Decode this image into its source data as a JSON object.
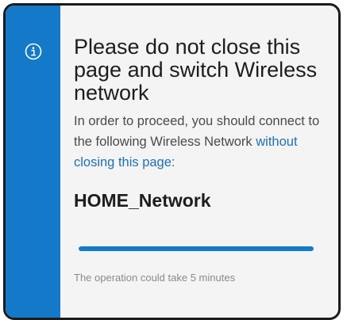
{
  "dialog": {
    "icon": "info-icon",
    "title": "Please do not close this page and switch Wireless network",
    "description_text": "In order to proceed, you should connect to the following Wireless Network ",
    "description_link": "without closing this page:",
    "network_name": "HOME_Network",
    "progress": 1.0,
    "note": "The operation could take 5 minutes"
  },
  "colors": {
    "accent": "#1479c8",
    "link": "#1f6fb5",
    "background": "#f4f4f4"
  }
}
